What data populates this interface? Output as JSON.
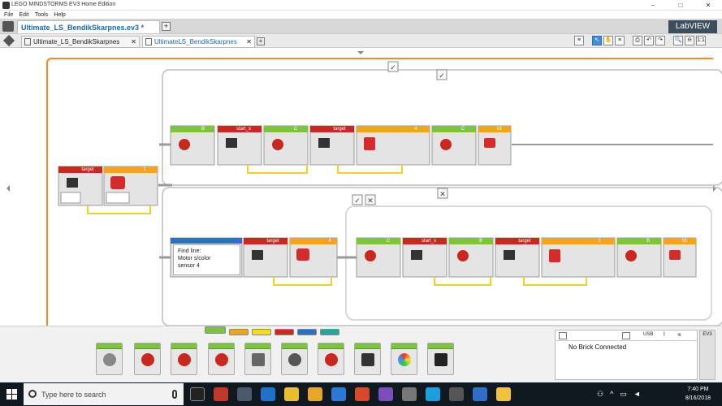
{
  "window": {
    "title": "LEGO MINDSTORMS EV3 Home Edition",
    "controls": [
      "–",
      "□",
      "✕"
    ]
  },
  "menu": [
    "File",
    "Edit",
    "Tools",
    "Help"
  ],
  "project": {
    "tab_label": "Ultimate_LS_BendikSkarpnes.ev3 *",
    "add": "+",
    "brand": "LabVIEW"
  },
  "program_tabs": [
    {
      "label": "Ultimate_LS_BendikSkarpnes",
      "close": "✕"
    },
    {
      "label": "UltimateLS_BendikSkarpnes",
      "close": "✕"
    }
  ],
  "program_add": "+",
  "toolbar": [
    "≡",
    "↖",
    "✋",
    "≡",
    "⎙",
    "↶",
    "↷",
    "🔍",
    "⊖",
    "1:1"
  ],
  "canvas": {
    "loop_labels": [
      "1",
      "target",
      "B",
      "start_s",
      "C",
      "target",
      "4",
      "C",
      "01",
      "target",
      "4",
      "C",
      "start_s",
      "B",
      "target",
      "1",
      "B",
      "01"
    ],
    "comment": "Find line:\nMotor s/color\nsensor 4",
    "checks": [
      "✓",
      "✓",
      "✓",
      "✕",
      "✕"
    ]
  },
  "palette_colors": [
    "#7ec43b",
    "#f2a51a",
    "#f5de12",
    "#d7241c",
    "#2f6fc6",
    "#1fa8a0"
  ],
  "hardware": {
    "status": "No Brick Connected",
    "tabs": [
      "USB",
      "BT",
      "Wi-Fi"
    ],
    "ev3": "EV3"
  },
  "taskbar": {
    "search_placeholder": "Type here to search",
    "time": "7:40 PM",
    "date": "8/16/2018"
  }
}
